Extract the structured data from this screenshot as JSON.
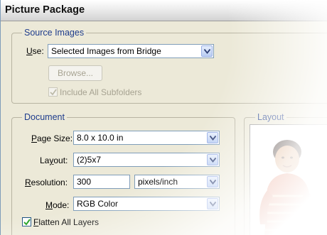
{
  "window": {
    "title": "Picture Package"
  },
  "source_images": {
    "legend": "Source Images",
    "use_label": "Use:",
    "use_value": "Selected Images from Bridge",
    "browse_label": "Browse...",
    "include_subfolders_label": "Include All Subfolders",
    "include_subfolders_checked": true
  },
  "document": {
    "legend": "Document",
    "page_size_label": "Page Size:",
    "page_size_value": "8.0 x 10.0 in",
    "layout_label": "Layout:",
    "layout_value": "(2)5x7",
    "resolution_label": "Resolution:",
    "resolution_value": "300",
    "resolution_unit": "pixels/inch",
    "mode_label": "Mode:",
    "mode_value": "RGB Color",
    "flatten_label": "Flatten All Layers",
    "flatten_checked": true
  },
  "layout_panel": {
    "legend": "Layout"
  },
  "icons": {
    "dropdown": "chevron-down-icon",
    "check": "checkmark-icon"
  },
  "colors": {
    "legend_text": "#1e3c8c",
    "dialog_bg": "#ece9d8",
    "field_border": "#7f9db9"
  }
}
